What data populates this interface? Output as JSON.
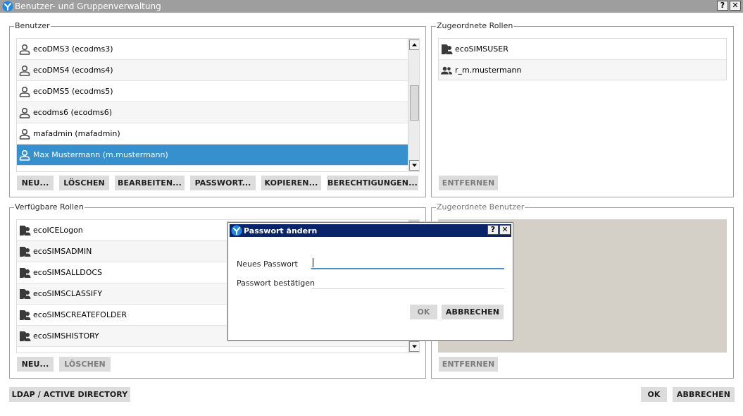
{
  "window": {
    "title": "Benutzer- und Gruppenverwaltung",
    "help": "?",
    "close": "✕"
  },
  "users": {
    "legend": "Benutzer",
    "items": [
      {
        "label": "ecoDMS3 (ecodms3)",
        "icon": "user-icon"
      },
      {
        "label": "ecoDMS4 (ecodms4)",
        "icon": "user-icon"
      },
      {
        "label": "ecoDMS5 (ecodms5)",
        "icon": "user-icon"
      },
      {
        "label": "ecodms6 (ecodms6)",
        "icon": "user-icon"
      },
      {
        "label": "mafadmin (mafadmin)",
        "icon": "user-icon"
      },
      {
        "label": "Max Mustermann (m.mustermann)",
        "icon": "user-icon",
        "selected": true
      }
    ],
    "buttons": {
      "new": "NEU...",
      "delete": "LÖSCHEN",
      "edit": "BEARBEITEN...",
      "password": "PASSWORT...",
      "copy": "KOPIEREN...",
      "permissions": "BERECHTIGUNGEN..."
    }
  },
  "assigned_roles": {
    "legend": "Zugeordnete Rollen",
    "items": [
      {
        "label": "ecoSIMSUSER",
        "icon": "role-icon"
      },
      {
        "label": "r_m.mustermann",
        "icon": "group-icon"
      }
    ],
    "remove": "ENTFERNEN"
  },
  "available_roles": {
    "legend": "Verfügbare Rollen",
    "items": [
      {
        "label": "ecoICELogon",
        "icon": "role-icon"
      },
      {
        "label": "ecoSIMSADMIN",
        "icon": "role-icon"
      },
      {
        "label": "ecoSIMSALLDOCS",
        "icon": "role-icon"
      },
      {
        "label": "ecoSIMSCLASSIFY",
        "icon": "role-icon"
      },
      {
        "label": "ecoSIMSCREATEFOLDER",
        "icon": "role-icon"
      },
      {
        "label": "ecoSIMSHISTORY",
        "icon": "role-icon"
      }
    ],
    "buttons": {
      "new": "NEU...",
      "delete": "LÖSCHEN"
    }
  },
  "assigned_users": {
    "legend": "Zugeordnete Benutzer",
    "remove": "ENTFERNEN"
  },
  "footer": {
    "ldap": "LDAP / ACTIVE DIRECTORY",
    "ok": "OK",
    "cancel": "ABBRECHEN"
  },
  "password_dialog": {
    "title": "Passwort ändern",
    "help": "?",
    "close": "✕",
    "new_password_label": "Neues Passwort",
    "new_password_value": "",
    "confirm_label": "Passwort bestätigen",
    "confirm_value": "",
    "ok": "OK",
    "cancel": "ABBRECHEN"
  },
  "colors": {
    "selection": "#3590cd",
    "dialog_title": "#0a246a",
    "window_title": "#9e9e9e",
    "button": "#dcdcdc",
    "input_focus": "#4a90c8"
  }
}
